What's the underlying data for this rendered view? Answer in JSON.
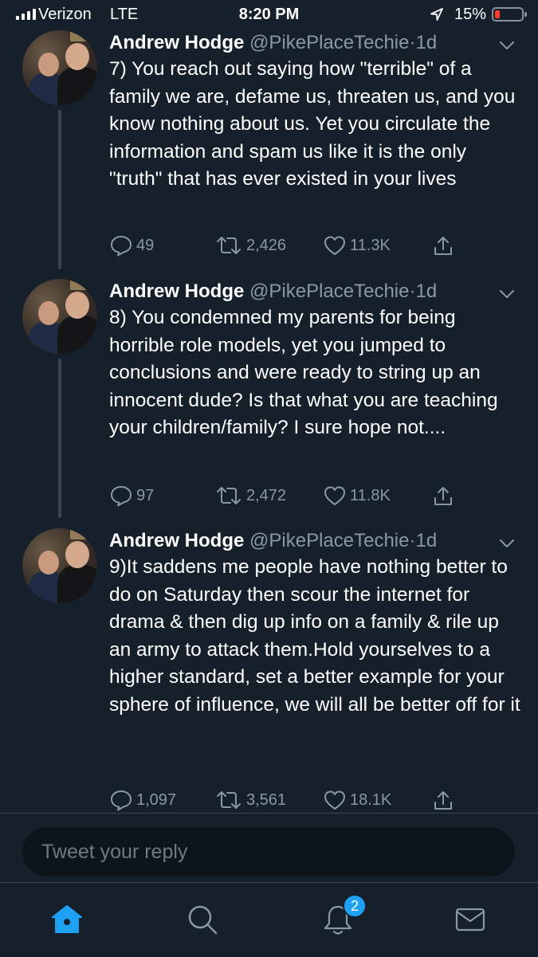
{
  "status_bar": {
    "carrier": "Verizon",
    "network": "LTE",
    "time": "8:20 PM",
    "battery": "15%",
    "battery_level": 0.15
  },
  "tweets": [
    {
      "name": "Andrew Hodge",
      "handle": "@PikePlaceTechie",
      "separator": "·",
      "time": "1d",
      "text": "7) You reach out saying how \"terrible\" of a family we are, defame us, threaten us, and you know nothing about us. Yet you circulate the information and spam us like it is the only \"truth\" that has ever existed in your lives",
      "replies": "49",
      "retweets": "2,426",
      "likes": "11.3K"
    },
    {
      "name": "Andrew Hodge",
      "handle": "@PikePlaceTechie",
      "separator": "·",
      "time": "1d",
      "text": "8) You condemned my parents for being horrible role models, yet you jumped to conclusions and were ready to string up an innocent dude? Is that what you are teaching your children/family? I sure hope not....",
      "replies": "97",
      "retweets": "2,472",
      "likes": "11.8K"
    },
    {
      "name": "Andrew Hodge",
      "handle": "@PikePlaceTechie",
      "separator": "·",
      "time": "1d",
      "text": "9)It saddens me people have nothing better to do on Saturday then scour the internet for drama & then dig up info on a family & rile up an army to attack them.Hold yourselves to a higher standard, set a better example for your sphere of influence, we will all be better off for it",
      "replies": "1,097",
      "retweets": "3,561",
      "likes": "18.1K"
    }
  ],
  "reply_box": {
    "placeholder": "Tweet your reply"
  },
  "tab_bar": {
    "tabs": [
      "home-icon",
      "search-icon",
      "notifications-icon",
      "messages-icon"
    ],
    "notifications_badge": "2"
  },
  "colors": {
    "background": "#15202b",
    "secondary_text": "#8899a6",
    "accent": "#1da1f2",
    "battery_low": "#ff3b30"
  }
}
